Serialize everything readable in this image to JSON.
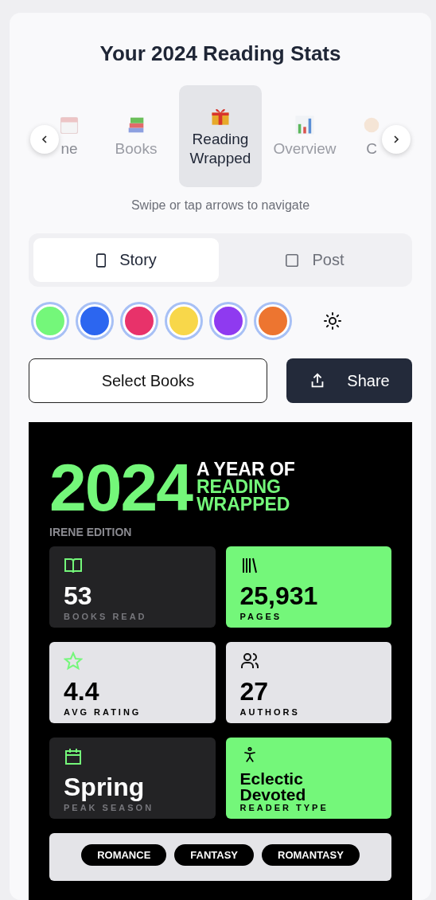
{
  "title": "Your 2024 Reading Stats",
  "carousel": [
    {
      "label": "ne",
      "selected": false,
      "faded": true
    },
    {
      "label": "Books",
      "selected": false,
      "faded": false
    },
    {
      "label": "Reading Wrapped",
      "selected": true,
      "faded": false
    },
    {
      "label": "Overview",
      "selected": false,
      "faded": false
    },
    {
      "label": "C",
      "selected": false,
      "faded": true
    }
  ],
  "hint": "Swipe or tap arrows to navigate",
  "formats": [
    {
      "label": "Story",
      "selected": true
    },
    {
      "label": "Post",
      "selected": false
    }
  ],
  "swatches": [
    {
      "color": "#74f77a"
    },
    {
      "color": "#2c66f0"
    },
    {
      "color": "#e8326a"
    },
    {
      "color": "#f8d74a"
    },
    {
      "color": "#8f3af0"
    },
    {
      "color": "#ed7530"
    }
  ],
  "buttons": {
    "select": "Select Books",
    "share": "Share"
  },
  "poster": {
    "year": "2024",
    "line1": "A YEAR OF",
    "line2": "READING",
    "line3": "WRAPPED",
    "edition": "IRENE EDITION",
    "stats": [
      {
        "value": "53",
        "label": "BOOKS READ",
        "kind": "dark"
      },
      {
        "value": "25,931",
        "label": "PAGES",
        "kind": "green"
      },
      {
        "value": "4.4",
        "label": "AVG RATING",
        "kind": "light"
      },
      {
        "value": "27",
        "label": "AUTHORS",
        "kind": "light"
      },
      {
        "value": "Spring",
        "label": "PEAK SEASON",
        "kind": "dark"
      },
      {
        "value": "Eclectic Devoted",
        "label": "READER TYPE",
        "kind": "green"
      }
    ],
    "genres": [
      "ROMANCE",
      "FANTASY",
      "ROMANTASY"
    ]
  }
}
